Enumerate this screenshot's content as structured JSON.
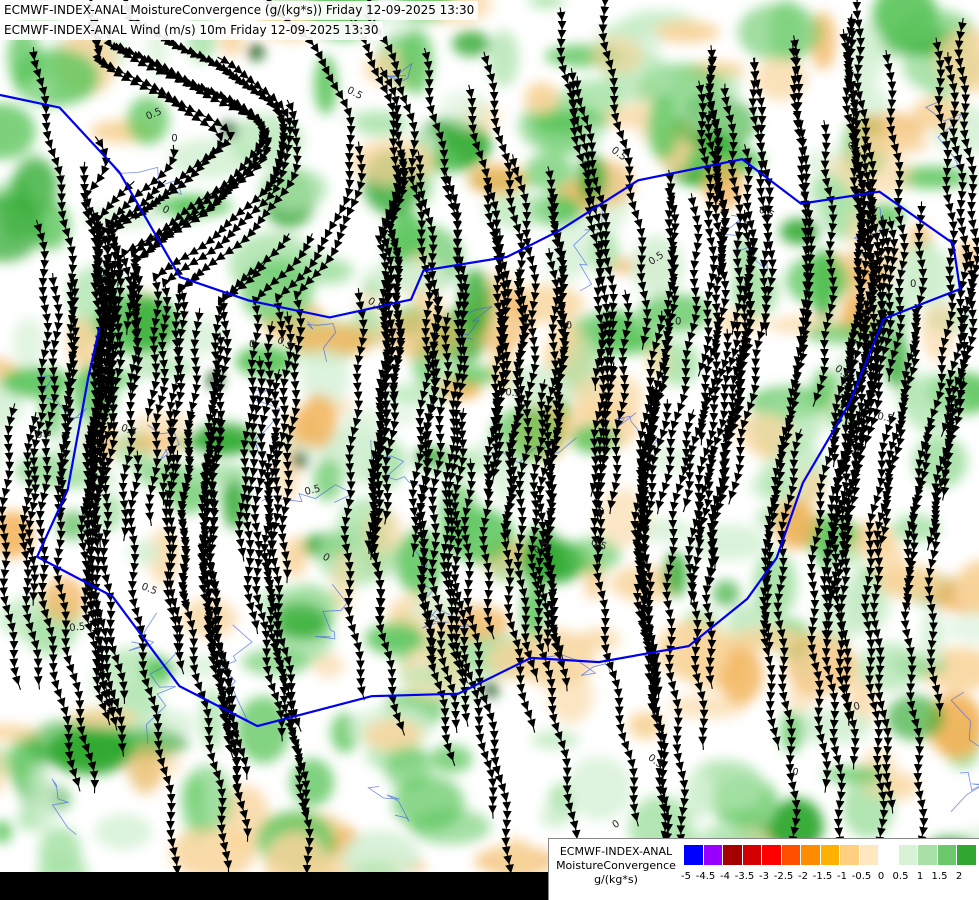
{
  "header": {
    "line1": "ECMWF-INDEX-ANAL MoistureConvergence (g/(kg*s)) Friday 12-09-2025 13:30",
    "line2": "ECMWF-INDEX-ANAL Wind (m/s) 10m Friday 12-09-2025 13:30"
  },
  "map": {
    "contour_labels": [
      "0.5",
      "0",
      "0.5",
      "0.5",
      "0",
      "0.5",
      "0",
      "0.5",
      "0.5",
      "0",
      "0.5",
      "0",
      "0.5",
      "0.5",
      "0",
      "0.5",
      "0",
      "0.5",
      "0.5",
      "0",
      "0.5",
      "0",
      "0.5",
      "0.5",
      "0",
      "0.5",
      "0",
      "0.5",
      "0.5",
      "0"
    ],
    "colors": {
      "strong_green": "#2ea82e",
      "mid_green": "#5dc65d",
      "light_green": "#a8e2a8",
      "pale_green": "#d4f0d4",
      "orange": "#f2b45c",
      "light_orange": "#f8d49a",
      "dark_patch": "#0a5a0a",
      "border": "#0000ee",
      "river": "#3a5ee8",
      "streamline": "#000000"
    }
  },
  "legend": {
    "title_lines": [
      "ECMWF-INDEX-ANAL",
      "MoistureConvergence",
      "g/(kg*s)"
    ],
    "swatch_colors": [
      "#0000ff",
      "#9b00ff",
      "#a50000",
      "#d40000",
      "#ff0000",
      "#ff5000",
      "#ff8c00",
      "#ffb000",
      "#ffd080",
      "#ffe8c0",
      "#ffffff",
      "#d8f2d8",
      "#a8e0a8",
      "#6cc86c",
      "#32a832"
    ],
    "ticks": [
      "-5",
      "-4.5",
      "-4",
      "-3.5",
      "-3",
      "-2.5",
      "-2",
      "-1.5",
      "-1",
      "-0.5",
      "0",
      "0.5",
      "1",
      "1.5",
      "2"
    ]
  }
}
